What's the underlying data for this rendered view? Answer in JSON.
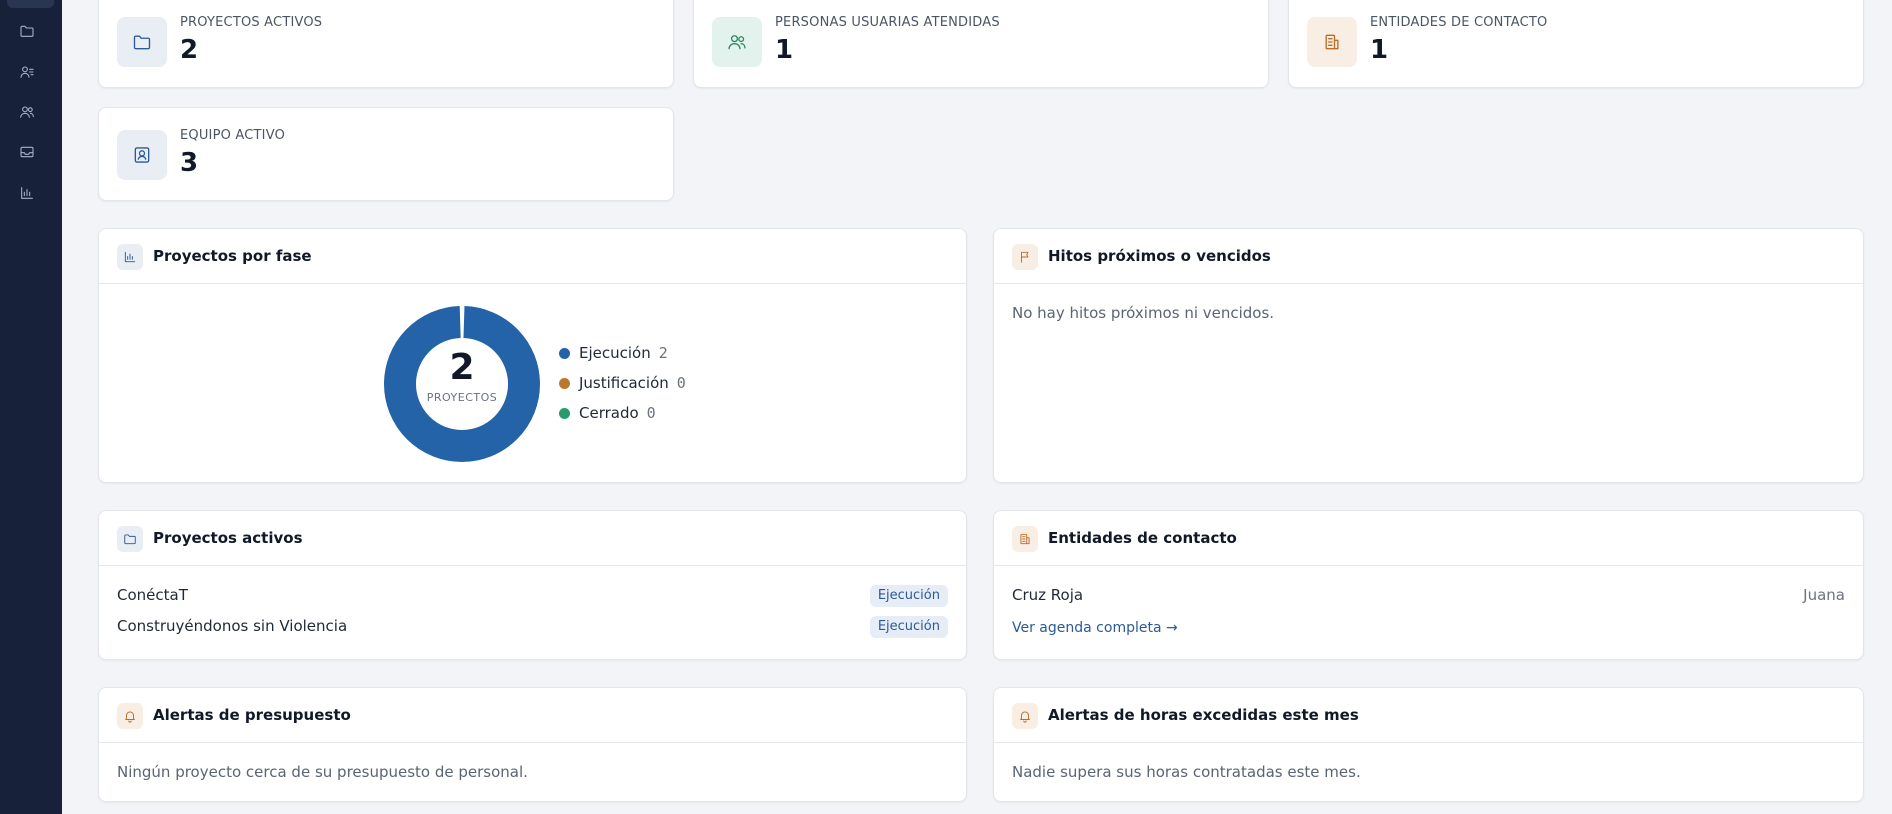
{
  "sidebar": {
    "icons": [
      "folder-icon",
      "user-list-icon",
      "users-icon",
      "inbox-icon",
      "bar-chart-icon"
    ]
  },
  "stats": [
    {
      "label": "PROYECTOS ACTIVOS",
      "value": "2",
      "icon": "folder-icon"
    },
    {
      "label": "PERSONAS USUARIAS ATENDIDAS",
      "value": "1",
      "icon": "users-icon"
    },
    {
      "label": "ENTIDADES DE CONTACTO",
      "value": "1",
      "icon": "building-icon"
    },
    {
      "label": "EQUIPO ACTIVO",
      "value": "3",
      "icon": "id-badge-icon"
    }
  ],
  "projects_by_phase": {
    "title": "Proyectos por fase",
    "center_value": "2",
    "center_label": "PROYECTOS"
  },
  "chart_data": {
    "type": "pie",
    "categories": [
      "Ejecución",
      "Justificación",
      "Cerrado"
    ],
    "values": [
      2,
      0,
      0
    ],
    "colors": [
      "#2563a8",
      "#b8782f",
      "#2a9a6e"
    ],
    "legend": "right"
  },
  "milestones": {
    "title": "Hitos próximos o vencidos",
    "empty": "No hay hitos próximos ni vencidos."
  },
  "active_projects": {
    "title": "Proyectos activos",
    "rows": [
      {
        "name": "ConéctaT",
        "phase": "Ejecución"
      },
      {
        "name": "Construyéndonos sin Violencia",
        "phase": "Ejecución"
      }
    ]
  },
  "contacts": {
    "title": "Entidades de contacto",
    "rows": [
      {
        "name": "Cruz Roja",
        "person": "Juana"
      }
    ],
    "link": "Ver agenda completa →"
  },
  "budget_alerts": {
    "title": "Alertas de presupuesto",
    "empty": "Ningún proyecto cerca de su presupuesto de personal."
  },
  "hours_alerts": {
    "title": "Alertas de horas excedidas este mes",
    "empty": "Nadie supera sus horas contratadas este mes."
  },
  "colors": {
    "sidebar": "#18213a",
    "accent_blue": "#2b5a96",
    "accent_green": "#2a8a63",
    "accent_orange": "#b96d2a"
  }
}
